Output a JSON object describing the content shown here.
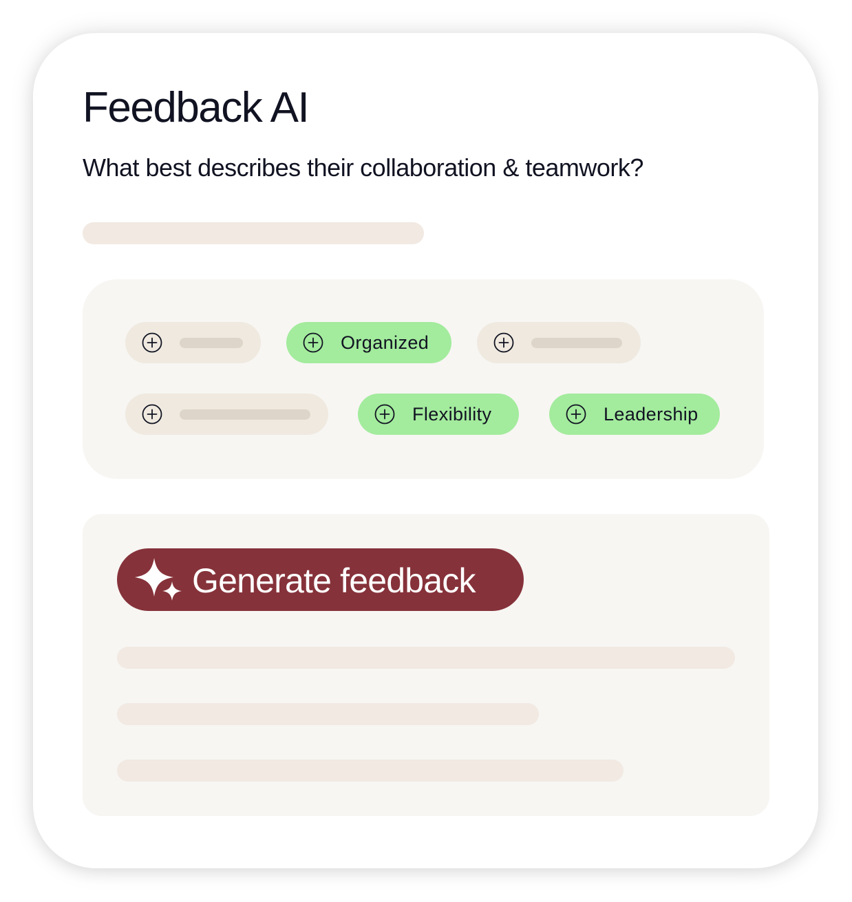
{
  "app": {
    "title": "Feedback AI",
    "question": "What best describes their collaboration & teamwork?"
  },
  "tags": [
    {
      "label": "",
      "selected": false,
      "icon": "plus-circle-icon"
    },
    {
      "label": "Organized",
      "selected": true,
      "icon": "plus-circle-icon"
    },
    {
      "label": "",
      "selected": false,
      "icon": "plus-circle-icon"
    },
    {
      "label": "",
      "selected": false,
      "icon": "plus-circle-icon"
    },
    {
      "label": "Flexibility",
      "selected": true,
      "icon": "plus-circle-icon"
    },
    {
      "label": "Leadership",
      "selected": true,
      "icon": "plus-circle-icon"
    }
  ],
  "generate": {
    "label": "Generate feedback",
    "icon": "sparkle-icon"
  },
  "colors": {
    "text": "#111322",
    "tag_selected": "#a3eb9d",
    "tag_placeholder": "#efe9df",
    "skeleton": "#f1e9e2",
    "panel": "#f7f6f3",
    "accent": "#86323a"
  }
}
